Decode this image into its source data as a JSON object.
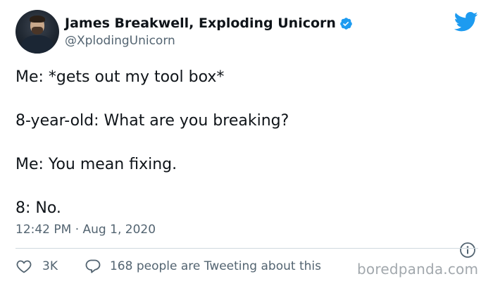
{
  "author": {
    "display_name": "James Breakwell, Exploding Unicorn",
    "handle": "@XplodingUnicorn",
    "verified": true
  },
  "tweet": {
    "lines": [
      "Me: *gets out my tool box*",
      "8-year-old: What are you breaking?",
      "Me: You mean fixing.",
      "8: No."
    ],
    "timestamp": "12:42 PM · Aug 1, 2020"
  },
  "engagement": {
    "likes": "3K",
    "conversation_text": "168 people are Tweeting about this"
  },
  "watermark": "boredpanda.com",
  "colors": {
    "twitter_blue": "#1d9bf0",
    "secondary_text": "#536471",
    "divider": "#cfd9de"
  },
  "icons": [
    "twitter-bird-icon",
    "verified-badge-icon",
    "info-icon",
    "heart-icon",
    "reply-bubble-icon"
  ]
}
